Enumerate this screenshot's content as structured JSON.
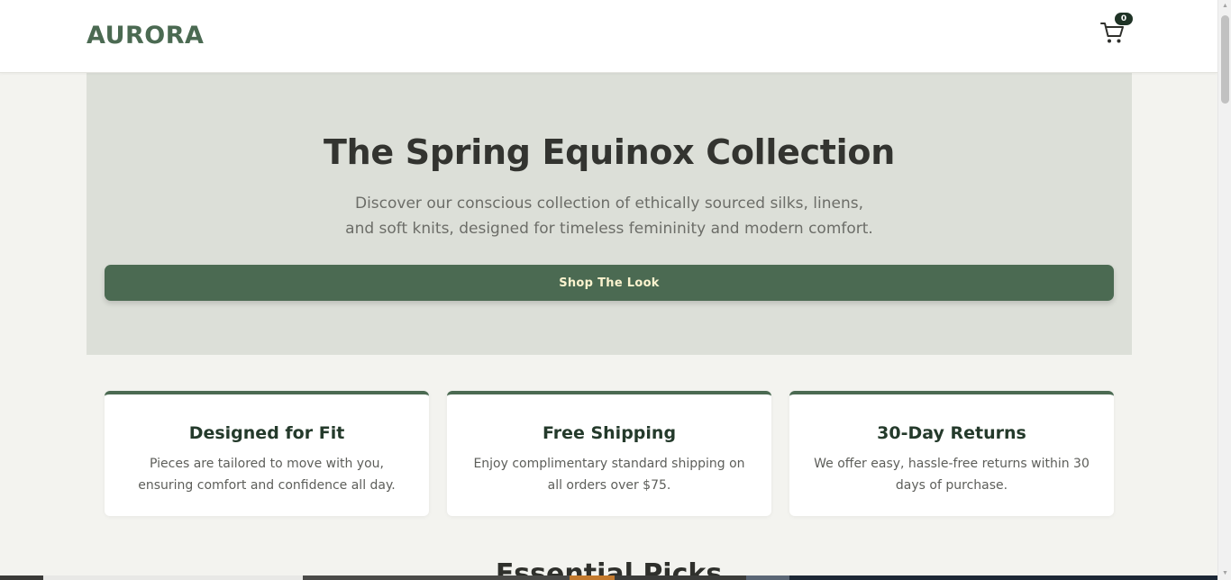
{
  "header": {
    "logo": "AURORA",
    "cart_icon": "cart-icon",
    "cart_count": "0"
  },
  "hero": {
    "title": "The Spring Equinox Collection",
    "description": "Discover our conscious collection of ethically sourced silks, linens, and soft knits, designed for timeless femininity and modern comfort.",
    "cta_label": "Shop The Look"
  },
  "features": [
    {
      "title": "Designed for Fit",
      "text": "Pieces are tailored to move with you, ensuring comfort and confidence all day."
    },
    {
      "title": "Free Shipping",
      "text": "Enjoy complimentary standard shipping on all orders over $75."
    },
    {
      "title": "30-Day Returns",
      "text": "We offer easy, hassle-free returns within 30 days of purchase."
    }
  ],
  "essentials": {
    "title": "Essential Picks"
  },
  "colors": {
    "accent": "#4b6a52",
    "hero_bg": "#dcdfd8",
    "page_bg": "#f3f3ef",
    "button_text": "#fbf3cf"
  }
}
